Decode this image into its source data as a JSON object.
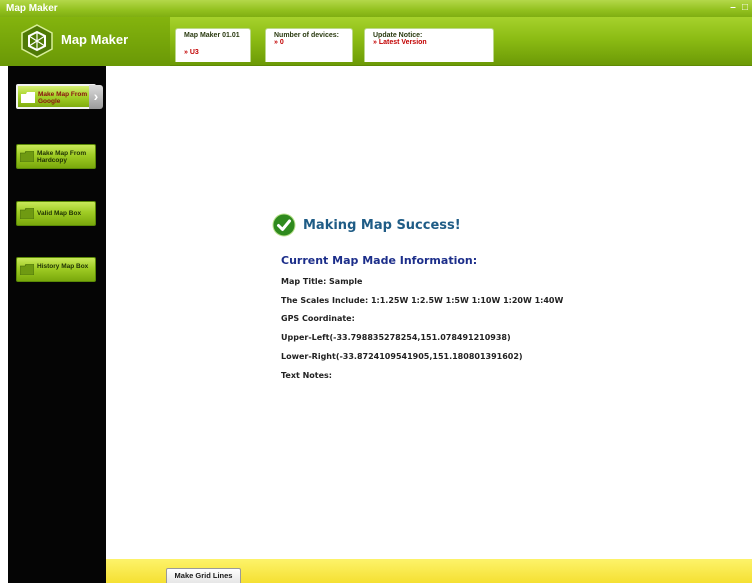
{
  "window": {
    "title": "Map Maker"
  },
  "header": {
    "app_name": "Map Maker",
    "version": {
      "title": "Map Maker 01.01",
      "value": "» U3"
    },
    "devices": {
      "title": "Number of devices:",
      "value": "» 0"
    },
    "update": {
      "title": "Update Notice:",
      "value": "» Latest Version"
    }
  },
  "sidebar": {
    "items": [
      {
        "label": "Make Map From Google",
        "active": true
      },
      {
        "label": "Make Map From Hardcopy",
        "active": false
      },
      {
        "label": "Valid Map Box",
        "active": false
      },
      {
        "label": "History Map Box",
        "active": false
      }
    ]
  },
  "main": {
    "success_message": "Making Map Success!",
    "info_heading": "Current Map Made Information:",
    "lines": [
      "Map Title:  Sample",
      "The Scales Include:  1:1.25W 1:2.5W 1:5W 1:10W 1:20W 1:40W",
      "GPS Coordinate:",
      "Upper-Left(-33.798835278254,151.078491210938)",
      "Lower-Right(-33.8724109541905,151.180801391602)",
      "Text Notes:"
    ]
  },
  "bottom": {
    "grid_button": "Make Grid Lines"
  },
  "colors": {
    "accent_green": "#8cbc14",
    "sidebar_bg": "#050505",
    "bottom_bar": "#f5e032",
    "heading_blue": "#1c2e8a",
    "alert_red": "#c20000"
  }
}
